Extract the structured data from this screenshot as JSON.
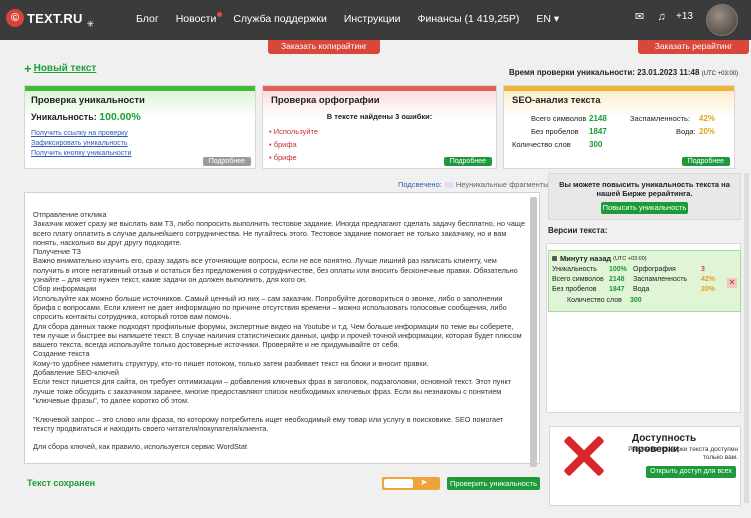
{
  "header": {
    "logo_text": "TEXT.RU",
    "nav": [
      "Блог",
      "Новости",
      "Служба поддержки",
      "Инструкции",
      "Финансы (1 419,25Р)",
      "EN"
    ],
    "user_count": "+13"
  },
  "orders": {
    "copywriting": "Заказать копирайтинг",
    "rewriting": "Заказать рерайтинг"
  },
  "new_text": "Новый текст",
  "check_time": {
    "label": "Время проверки уникальности: 23.01.2023 11:48",
    "tz": "(UTC +03:00)"
  },
  "uniqueness": {
    "title": "Проверка уникальности",
    "label": "Уникальность:",
    "value": "100.00%",
    "links": [
      "Получить ссылку на проверку",
      "Зафиксировать уникальность",
      "Получить кнопку уникальности"
    ],
    "more": "Подробнее"
  },
  "spelling": {
    "title": "Проверка орфографии",
    "subtitle": "В тексте найдены 3 ошибки:",
    "errors": [
      "Используйте",
      "брифа",
      "брифе"
    ],
    "more": "Подробнее"
  },
  "seo": {
    "title": "SEO-анализ текста",
    "chars_label": "Всего символов",
    "chars": "2148",
    "nospace_label": "Без пробелов",
    "nospace": "1847",
    "words_label": "Количество слов",
    "words": "300",
    "spam_label": "Заспамленность:",
    "spam": "42%",
    "water_label": "Вода:",
    "water": "20%",
    "more": "Подробнее"
  },
  "editor": {
    "sourced_label": "Подсвечено:",
    "nonunique_label": "Неуникальные фрагменты",
    "paragraphs": [
      "Отправление отклика",
      "Заказчик может сразу же выслать вам ТЗ, либо попросить выполнить тестовое задание. Иногда предлагают сделать задачу бесплатно, но чаще всего плату оплатить в случае дальнейшего сотрудничества. Не пугайтесь этого. Тестовое задание помогает не только заказчику, но и вам понять, насколько вы друг другу подходите.",
      "Получение ТЗ",
      "Важно внимательно изучить его, сразу задать все уточняющие вопросы, если не все понятно. Лучше лишний раз написать клиенту, чем получить в итоге негативный отзыв и остаться без предложения о сотрудничестве, без оплаты или вносить бесконечные правки. Обязательно узнайте – для чего нужен текст, какие задачи он должен выполнить, для кого он.",
      "Сбор информации",
      "Используйте как можно больше источников. Самый ценный из них – сам заказчик. Попробуйте договориться о звонке, либо о заполнении брифа с вопросами. Если клиент не дает информацию по причине отсутствия времени – можно использовать голосовые сообщения, либо спросить контакты сотрудника, который готов вам помочь.",
      "Для сбора данных также подходят профильные форумы, экспертные видео на Youtube и т.д. Чем больше информации по теме вы соберете, тем лучше и быстрее вы напишете текст. В случае наличия статистических данных, цифр и прочей точной информации, которая будет плюсом вашего текста, всегда используйте только достоверные источники. Проверяйте и не придумывайте от себя.",
      "Создание текста",
      "Кому-то удобнее наметить структуру, кто-то пишет потоком, только затем разбивает текст на блоки и вносит правки.",
      "Добавление SEO-ключей",
      "Если текст пишется для сайта, он требует оптимизации – добавления ключевых фраз в заголовок, подзаголовки, основной текст. Этот пункт лучше тоже обсудить с заказчиком заранее, многие предоставляют список необходимых ключевых фраз. Если вы незнакомы с понятием \"ключевые фразы\", то далее коротко об этом.",
      "",
      "\"Ключевой запрос – это слово или фраза, по которому потребитель ищет необходимый ему товар или услугу в поисковике. SEO помогает тексту продвигаться и находить своего читателя/покупателя/клиента.",
      "",
      "Для сбора ключей, как правило, используется сервис WordStat"
    ],
    "saved": "Текст сохранен",
    "check_button": "Проверить уникальность"
  },
  "raise": {
    "text": "Вы можете повысить уникальность текста на нашей Бирже рерайтинга.",
    "button": "Повысить уникальность"
  },
  "versions": {
    "label": "Версии текста:",
    "item": {
      "time": "Минуту назад",
      "tz": "(UTC +03:00)",
      "uniq_label": "Уникальность",
      "uniq": "100%",
      "chars_label": "Всего символов",
      "chars": "2148",
      "nospace_label": "Без пробелов",
      "nospace": "1847",
      "words_label": "Количество слов",
      "words": "300",
      "spell_label": "Орфография",
      "spell": "3",
      "spam_label": "Заспамленность",
      "spam": "42%",
      "water_label": "Вода",
      "water": "20%"
    }
  },
  "access": {
    "title": "Доступность проверки",
    "subtitle": "Результат проверки текста доступен только вам.",
    "button": "Открыть доступ для всех"
  }
}
